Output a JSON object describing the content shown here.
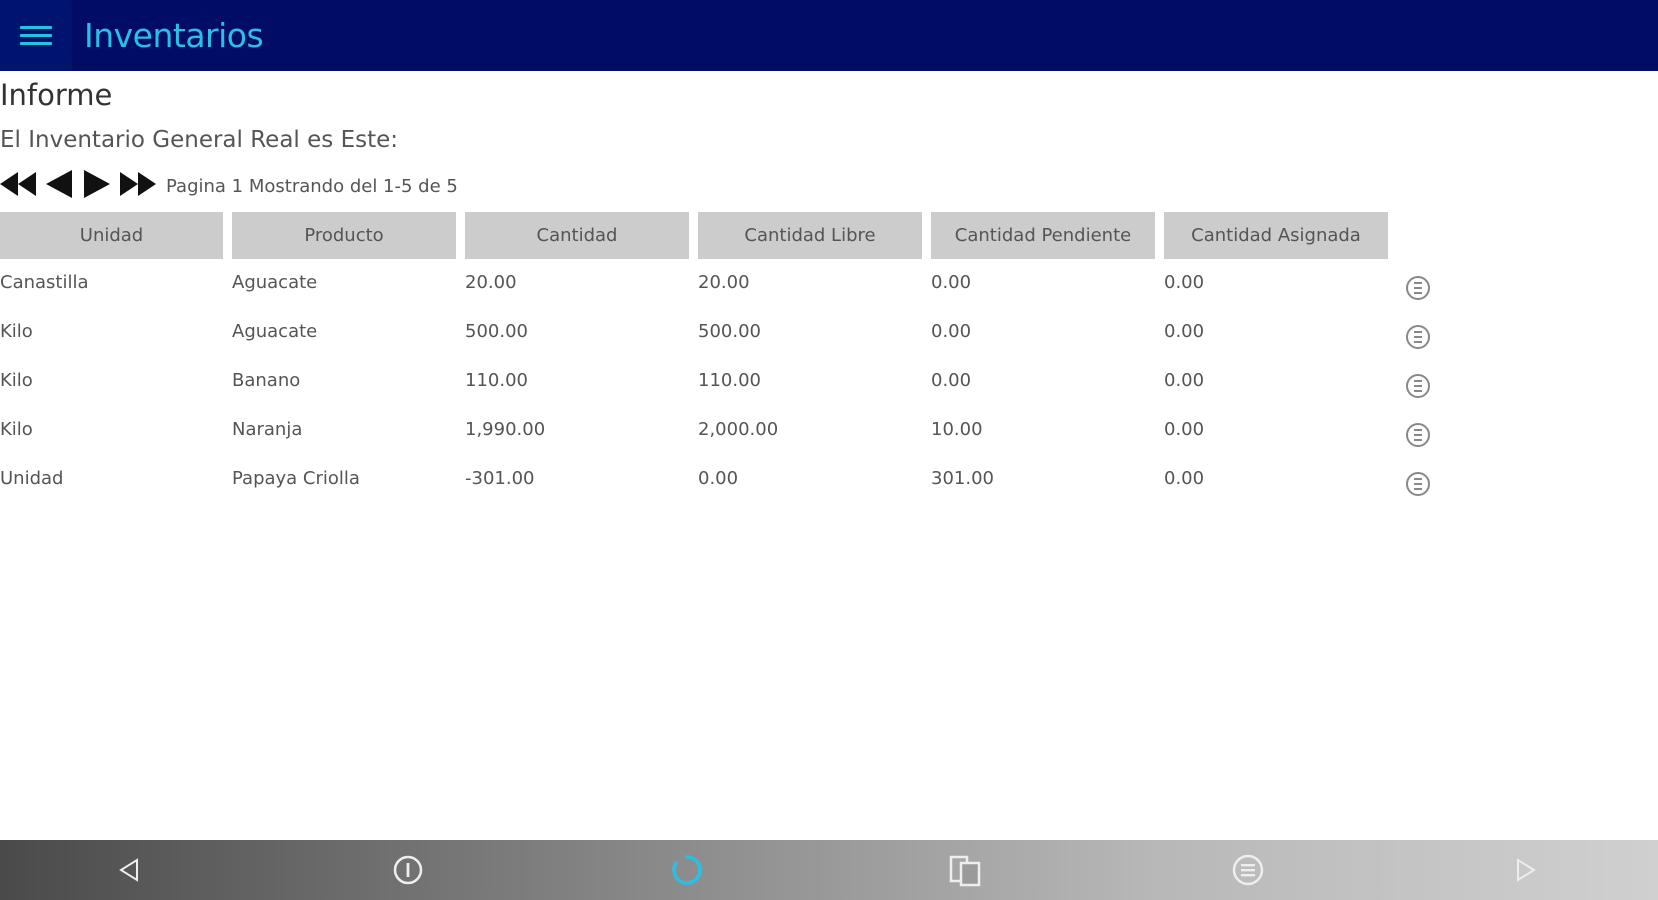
{
  "app": {
    "title": "Inventarios"
  },
  "page": {
    "heading": "Informe",
    "subheading": "El Inventario General Real es Este:"
  },
  "pager": {
    "info": "Pagina 1 Mostrando del 1-5 de 5"
  },
  "table": {
    "columns": [
      "Unidad",
      "Producto",
      "Cantidad",
      "Cantidad Libre",
      "Cantidad Pendiente",
      "Cantidad Asignada"
    ],
    "rows": [
      [
        "Canastilla",
        "Aguacate",
        "20.00",
        "20.00",
        "0.00",
        "0.00"
      ],
      [
        "Kilo",
        "Aguacate",
        "500.00",
        "500.00",
        "0.00",
        "0.00"
      ],
      [
        "Kilo",
        "Banano",
        "110.00",
        "110.00",
        "0.00",
        "0.00"
      ],
      [
        "Kilo",
        "Naranja",
        "1,990.00",
        "2,000.00",
        "10.00",
        "0.00"
      ],
      [
        "Unidad",
        "Papaya Criolla",
        "-301.00",
        "0.00",
        "301.00",
        "0.00"
      ]
    ]
  },
  "icons": {
    "menu": "hamburger-icon",
    "pager": [
      "first-page-icon",
      "previous-page-icon",
      "next-page-icon",
      "last-page-icon"
    ],
    "row_action": "details-icon",
    "appbar": [
      "back-icon",
      "info-icon",
      "refresh-icon",
      "copy-icon",
      "details-icon",
      "forward-icon"
    ]
  },
  "colors": {
    "titlebar": "#000c66",
    "accent": "#29c0e6",
    "header_cell": "#cccccc"
  }
}
